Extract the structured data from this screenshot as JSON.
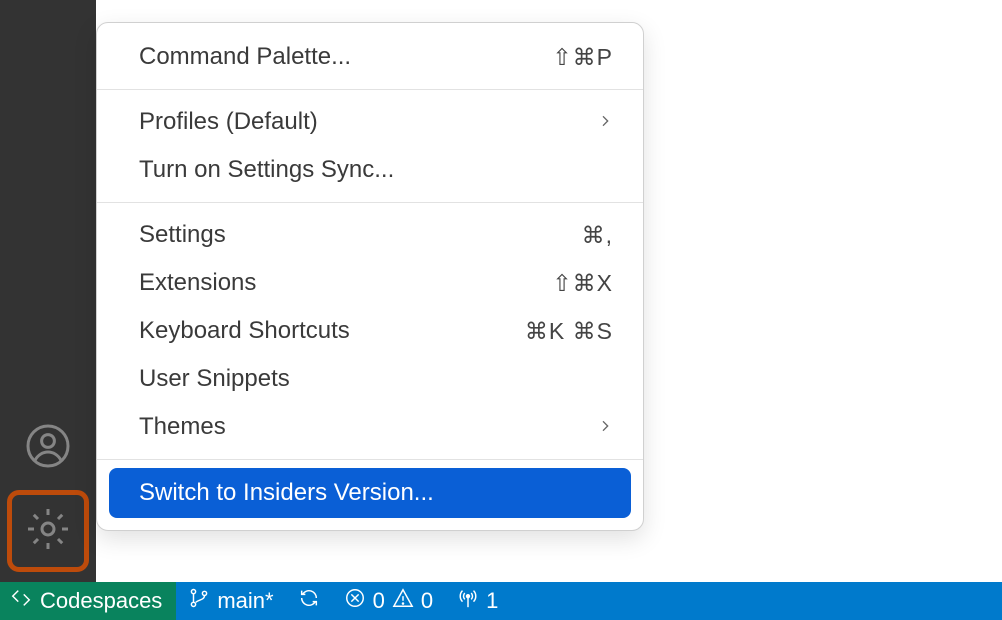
{
  "menu": {
    "command_palette": {
      "label": "Command Palette...",
      "shortcut": "⇧⌘P"
    },
    "profiles": {
      "label": "Profiles (Default)"
    },
    "settings_sync": {
      "label": "Turn on Settings Sync..."
    },
    "settings": {
      "label": "Settings",
      "shortcut": "⌘,"
    },
    "extensions": {
      "label": "Extensions",
      "shortcut": "⇧⌘X"
    },
    "keyboard": {
      "label": "Keyboard Shortcuts",
      "shortcut": "⌘K ⌘S"
    },
    "snippets": {
      "label": "User Snippets"
    },
    "themes": {
      "label": "Themes"
    },
    "insiders": {
      "label": "Switch to Insiders Version..."
    }
  },
  "status": {
    "remote_label": "Codespaces",
    "branch": "main*",
    "errors": "0",
    "warnings": "0",
    "ports": "1"
  }
}
